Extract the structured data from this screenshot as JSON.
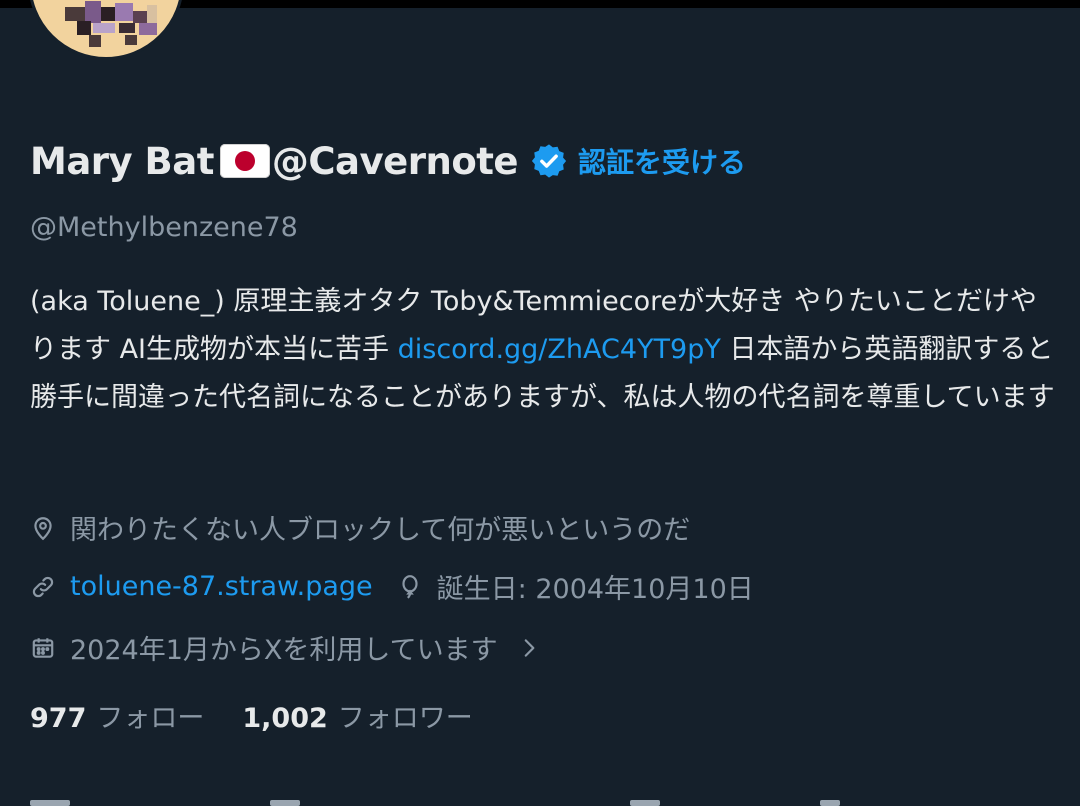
{
  "profile": {
    "display_name": "Mary Bat",
    "name_suffix": "@Cavernote",
    "flag_icon": "japan-flag-icon",
    "verified_icon": "verified-badge-icon",
    "verify_link": "認証を受ける",
    "handle": "@Methylbenzene78"
  },
  "bio": {
    "text1": "(aka Toluene_) 原理主義オタク Toby&Temmiecoreが大好き やりたいことだけやります AI生成物が本当に苦手 ",
    "link": "discord.gg/ZhAC4YT9pY",
    "text2": " 日本語から英語翻訳すると勝手に間違った代名詞になることがありますが、私は人物の代名詞を尊重しています"
  },
  "meta": {
    "location_icon": "location-pin-icon",
    "location": "関わりたくない人ブロックして何が悪いというのだ",
    "link_icon": "link-icon",
    "website": "toluene-87.straw.page",
    "birthday_icon": "balloon-icon",
    "birthday": "誕生日: 2004年10月10日",
    "joined_icon": "calendar-icon",
    "joined": "2024年1月からXを利用しています",
    "chevron_icon": "chevron-right-icon"
  },
  "stats": {
    "following_count": "977",
    "following_label": "フォロー",
    "followers_count": "1,002",
    "followers_label": "フォロワー"
  },
  "colors": {
    "background": "#15202b",
    "accent": "#1d9bf0",
    "secondary_text": "#8b98a5",
    "primary_text": "#e7e9ea"
  }
}
